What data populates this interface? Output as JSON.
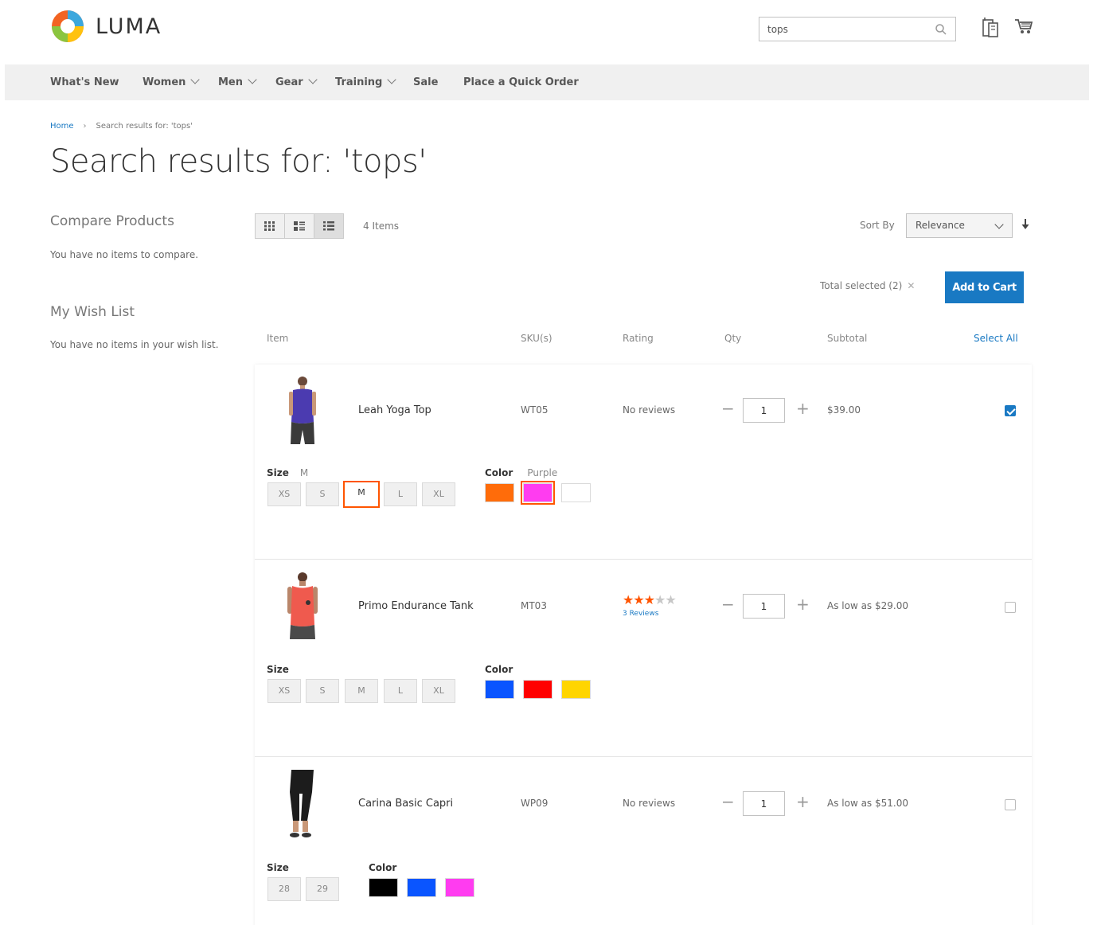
{
  "brand": {
    "name": "LUMA"
  },
  "search": {
    "value": "tops"
  },
  "nav": [
    {
      "label": "What's New",
      "has_dropdown": false
    },
    {
      "label": "Women",
      "has_dropdown": true
    },
    {
      "label": "Men",
      "has_dropdown": true
    },
    {
      "label": "Gear",
      "has_dropdown": true
    },
    {
      "label": "Training",
      "has_dropdown": true
    },
    {
      "label": "Sale",
      "has_dropdown": false
    },
    {
      "label": "Place a Quick Order",
      "has_dropdown": false
    }
  ],
  "breadcrumb": {
    "home": "Home",
    "current": "Search results for: 'tops'"
  },
  "page_title": "Search results for: 'tops'",
  "sidebar": {
    "compare_title": "Compare Products",
    "compare_text": "You have no items to compare.",
    "wishlist_title": "My Wish List",
    "wishlist_text": "You have no items in your wish list."
  },
  "toolbar": {
    "items_count": "4 Items",
    "sort_label": "Sort By",
    "sort_value": "Relevance",
    "view_modes": [
      "grid-icon",
      "list-icon",
      "table-icon"
    ]
  },
  "selection": {
    "total_selected": "Total selected (2)",
    "add_to_cart": "Add to Cart"
  },
  "columns": {
    "item": "Item",
    "sku": "SKU(s)",
    "rating": "Rating",
    "qty": "Qty",
    "subtotal": "Subtotal",
    "select_all": "Select All"
  },
  "products": [
    {
      "name": "Leah Yoga Top",
      "sku": "WT05",
      "rating_text": "No reviews",
      "qty": "1",
      "subtotal": "$39.00",
      "checked": true,
      "size_label": "Size",
      "size_selected": "M",
      "sizes": [
        "XS",
        "S",
        "M",
        "L",
        "XL"
      ],
      "color_label": "Color",
      "color_selected": "Purple",
      "colors": [
        "#ff6c0a",
        "#ff3cf0",
        "#ffffff"
      ]
    },
    {
      "name": "Primo Endurance Tank",
      "sku": "MT03",
      "rating_stars": 3,
      "rating_max": 5,
      "reviews_text": "3 Reviews",
      "qty": "1",
      "subtotal": "As low as $29.00",
      "checked": false,
      "size_label": "Size",
      "sizes": [
        "XS",
        "S",
        "M",
        "L",
        "XL"
      ],
      "color_label": "Color",
      "colors": [
        "#0a55ff",
        "#ff0000",
        "#ffd500"
      ]
    },
    {
      "name": "Carina Basic Capri",
      "sku": "WP09",
      "rating_text": "No reviews",
      "qty": "1",
      "subtotal": "As low as $51.00",
      "checked": false,
      "size_label": "Size",
      "sizes": [
        "28",
        "29"
      ],
      "color_label": "Color",
      "colors": [
        "#000000",
        "#0a55ff",
        "#ff3cf0"
      ]
    }
  ],
  "colors": {
    "accent": "#1979c3",
    "selected_border": "#ff5501",
    "star_on": "#ff5501",
    "nav_bg": "#f0f0f0"
  }
}
